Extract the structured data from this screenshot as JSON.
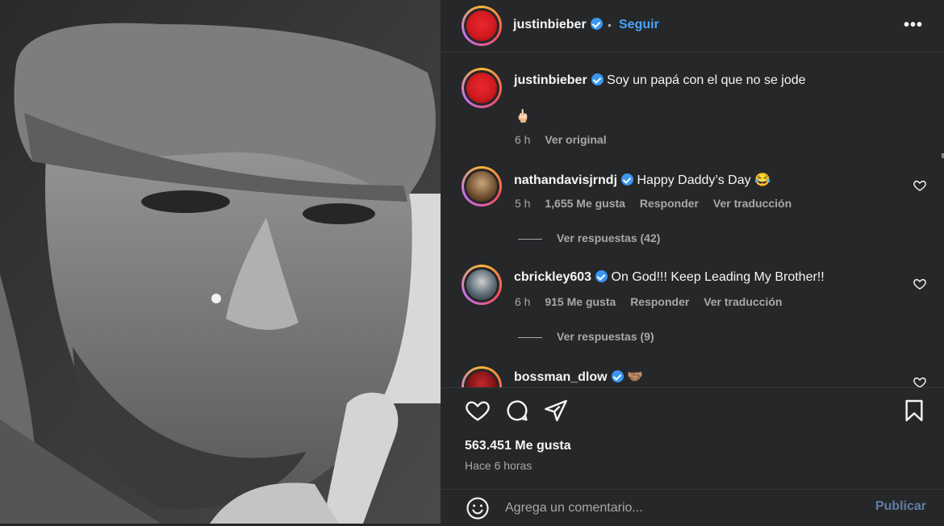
{
  "post": {
    "username": "justinbieber",
    "follow_label": "Seguir",
    "dot": "•",
    "more_label": "•••"
  },
  "caption": {
    "username": "justinbieber",
    "text": "Soy un papá con el que no se jode",
    "emoji": "🖕🏻",
    "time": "6 h",
    "see_original": "Ver original"
  },
  "comments": [
    {
      "username": "nathandavisjrndj",
      "text": "Happy Daddy’s Day 😂",
      "time": "5 h",
      "likes": "1,655 Me gusta",
      "reply": "Responder",
      "translate": "Ver traducción",
      "view_replies": "Ver respuestas (42)"
    },
    {
      "username": "cbrickley603",
      "text": "On God!!! Keep Leading My Brother!!",
      "time": "6 h",
      "likes": "915 Me gusta",
      "reply": "Responder",
      "translate": "Ver traducción",
      "view_replies": "Ver respuestas (9)"
    },
    {
      "username": "bossman_dlow",
      "text": "🤝🏽"
    }
  ],
  "stats": {
    "likes": "563.451 Me gusta",
    "time": "Hace 6 horas"
  },
  "comment_box": {
    "placeholder": "Agrega un comentario...",
    "publish_label": "Publicar"
  },
  "colors": {
    "background": "#262729",
    "accent": "#4aa3ff",
    "verified": "#3897f0",
    "muted": "#a8a8a8"
  },
  "icons": [
    "heart-icon",
    "comment-icon",
    "share-icon",
    "bookmark-icon",
    "emoji-icon",
    "more-icon",
    "verified-icon"
  ]
}
